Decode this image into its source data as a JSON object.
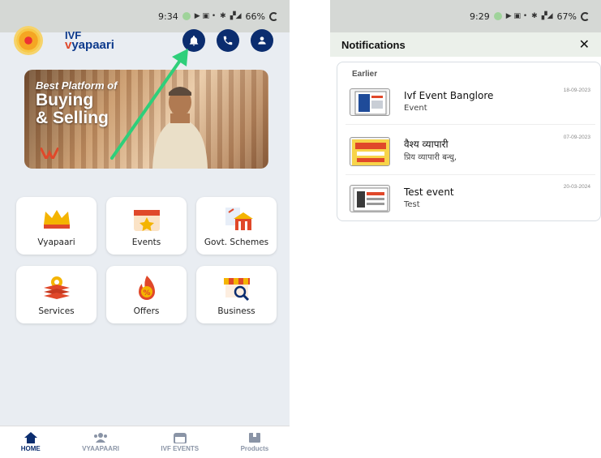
{
  "left": {
    "status": {
      "time": "9:34",
      "battery": "66%"
    },
    "brand": {
      "top": "IVF",
      "name_a": "v",
      "name_b": "yapaari"
    },
    "banner": {
      "line1": "Best Platform of",
      "line2": "Buying",
      "line3": "& Selling"
    },
    "tiles": [
      {
        "label": "Vyapaari",
        "icon": "crown-icon"
      },
      {
        "label": "Events",
        "icon": "calendar-star-icon"
      },
      {
        "label": "Govt. Schemes",
        "icon": "govt-building-icon"
      },
      {
        "label": "Services",
        "icon": "layers-gear-icon"
      },
      {
        "label": "Offers",
        "icon": "discount-flame-icon"
      },
      {
        "label": "Business",
        "icon": "store-search-icon"
      }
    ],
    "nav": [
      {
        "label": "HOME",
        "icon": "home-icon",
        "active": true
      },
      {
        "label": "VYAAPAARI",
        "icon": "people-icon",
        "active": false
      },
      {
        "label": "IVF EVENTS",
        "icon": "calendar-icon",
        "active": false
      },
      {
        "label": "Products",
        "icon": "box-icon",
        "active": false
      }
    ],
    "colors": {
      "primary": "#0b2d6f",
      "arrow": "#2ecf7a",
      "background": "#e9edf2"
    }
  },
  "right": {
    "status": {
      "time": "9:29",
      "battery": "67%"
    },
    "header": {
      "title": "Notifications",
      "close": "✕"
    },
    "section": "Earlier",
    "items": [
      {
        "title": "Ivf Event Banglore",
        "subtitle": "Event",
        "date": "18-09-2023"
      },
      {
        "title": "वैश्य व्यापारी",
        "subtitle": "प्रिय व्यापारी बन्धु,",
        "date": "07-09-2023"
      },
      {
        "title": "Test event",
        "subtitle": "Test",
        "date": "20-03-2024"
      }
    ]
  }
}
